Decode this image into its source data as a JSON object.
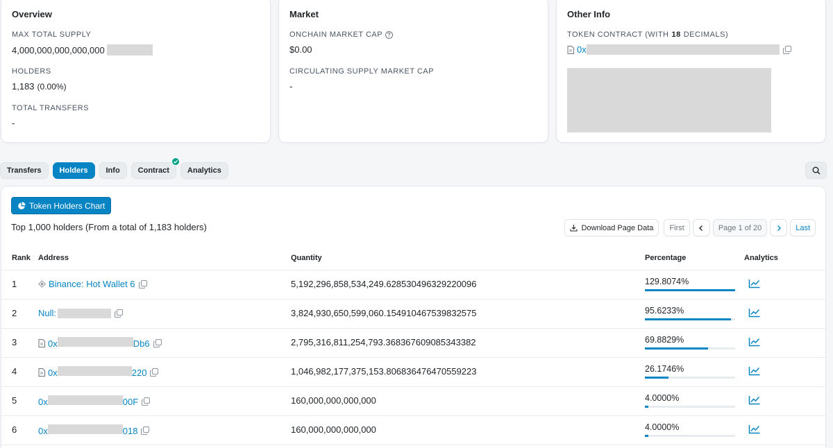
{
  "overview": {
    "title": "Overview",
    "max_supply_label": "MAX TOTAL SUPPLY",
    "max_supply_value": "4,000,000,000,000,000",
    "holders_label": "HOLDERS",
    "holders_value": "1,183",
    "holders_change": "(0.00%)",
    "transfers_label": "TOTAL TRANSFERS",
    "transfers_value": "-"
  },
  "market": {
    "title": "Market",
    "onchain_cap_label": "ONCHAIN MARKET CAP",
    "onchain_cap_value": "$0.00",
    "circ_cap_label": "CIRCULATING SUPPLY MARKET CAP",
    "circ_cap_value": "-"
  },
  "other": {
    "title": "Other Info",
    "contract_label_pre": "TOKEN CONTRACT (WITH",
    "contract_decimals": "18",
    "contract_label_post": "DECIMALS)",
    "contract_prefix": "0x"
  },
  "tabs": [
    "Transfers",
    "Holders",
    "Info",
    "Contract",
    "Analytics"
  ],
  "panel": {
    "chart_button": "Token Holders Chart",
    "summary": "Top 1,000 holders (From a total of 1,183 holders)",
    "download": "Download Page Data",
    "first": "First",
    "page": "Page 1 of 20",
    "last": "Last"
  },
  "table": {
    "headers": {
      "rank": "Rank",
      "address": "Address",
      "quantity": "Quantity",
      "percentage": "Percentage",
      "analytics": "Analytics"
    },
    "rows": [
      {
        "rank": "1",
        "addr_pre": "Binance: Hot Wallet 6",
        "addr_post": "",
        "quantity": "5,192,296,858,534,249.628530496329220096",
        "percentage": "129.8074%",
        "fill": 1.0
      },
      {
        "rank": "2",
        "addr_pre": "Null:",
        "addr_post": "",
        "quantity": "3,824,930,650,599,060.154910467539832575",
        "percentage": "95.6233%",
        "fill": 0.956
      },
      {
        "rank": "3",
        "addr_pre": "0x",
        "addr_post": "Db6",
        "quantity": "2,795,316,811,254,793.368367609085343382",
        "percentage": "69.8829%",
        "fill": 0.699
      },
      {
        "rank": "4",
        "addr_pre": "0x",
        "addr_post": "220",
        "quantity": "1,046,982,177,375,153.806836476470559223",
        "percentage": "26.1746%",
        "fill": 0.262
      },
      {
        "rank": "5",
        "addr_pre": "0x",
        "addr_post": "00F",
        "quantity": "160,000,000,000,000",
        "percentage": "4.0000%",
        "fill": 0.04
      },
      {
        "rank": "6",
        "addr_pre": "0x",
        "addr_post": "018",
        "quantity": "160,000,000,000,000",
        "percentage": "4.0000%",
        "fill": 0.04
      }
    ]
  },
  "colors": {
    "accent": "#0784c3",
    "verified": "#00a186",
    "redaction": "#d9d9d9"
  }
}
